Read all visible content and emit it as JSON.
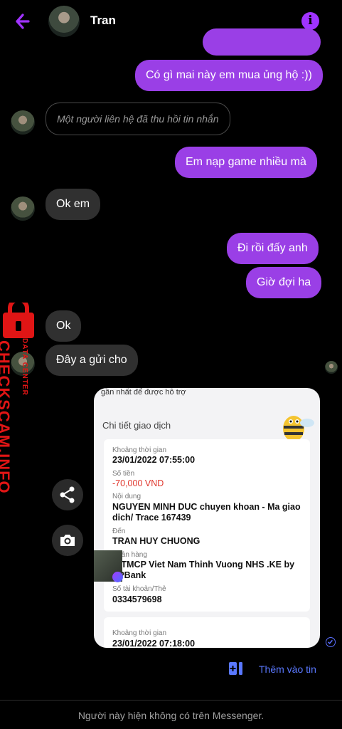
{
  "header": {
    "contact_name": "Tran"
  },
  "messages": {
    "m1": "Có gì mai này em mua ủng hộ :))",
    "m2": "Một người liên hệ đã thu hồi tin nhắn",
    "m3": "Em nạp game nhiều mà",
    "m4": "Ok em",
    "m5": "Đi rồi đấy anh",
    "m6": "Giờ đợi ha",
    "m7": "Ok",
    "m8": "Đây a gửi cho"
  },
  "watermark": {
    "brand": "CHECKSCAM.INFO",
    "sub": "DATA CENTER"
  },
  "receipt": {
    "top_text": "gần nhất để được hỗ trợ",
    "title": "Chi tiết giao dịch",
    "time_label": "Khoảng thời gian",
    "time_value": "23/01/2022 07:55:00",
    "amount_label": "Số tiền",
    "amount_value": "-70,000 VND",
    "content_label": "Nội dung",
    "content_value": "NGUYEN MINH DUC chuyen khoan - Ma giao dich/ Trace 167439",
    "to_label": "Đến",
    "to_value": "TRAN HUY CHUONG",
    "bank_label": "Ngân hàng",
    "bank_value": "H TMCP Viet Nam Thinh Vuong NHS .KE by VPBank",
    "account_label": "Số tài khoản/Thẻ",
    "account_value": "0334579698",
    "time2_label": "Khoảng thời gian",
    "time2_value": "23/01/2022 07:18:00"
  },
  "add_to_story": "Thêm vào tin",
  "footer": {
    "status": "Người này hiện không có trên Messenger."
  },
  "colors": {
    "accent": "#9a3fe6",
    "link": "#5a78ff",
    "incoming": "#303030",
    "watermark": "#e01515"
  }
}
